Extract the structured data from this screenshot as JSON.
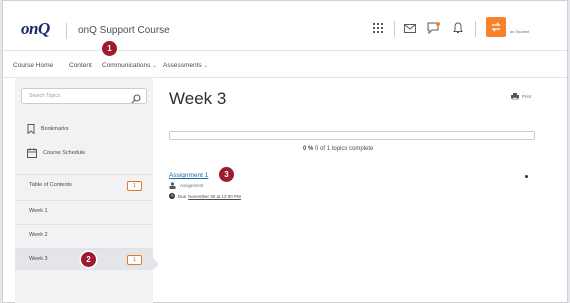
{
  "header": {
    "logo": "onQ",
    "course_title": "onQ Support Course",
    "role_label": "as Student",
    "icons": [
      "waffle-icon",
      "mail-icon",
      "chat-icon",
      "bell-icon",
      "role-switch-icon"
    ],
    "colors": {
      "accent": "#f7822b",
      "logo": "#1b2a6b"
    }
  },
  "nav": {
    "items": [
      {
        "label": "Course Home"
      },
      {
        "label": "Content"
      },
      {
        "label": "Communications",
        "dropdown": true
      },
      {
        "label": "Assessments",
        "dropdown": true
      }
    ]
  },
  "markers": {
    "m1": "1",
    "m2": "2",
    "m3": "3"
  },
  "sidebar": {
    "search_placeholder": "Search Topics",
    "bookmarks": "Bookmarks",
    "schedule": "Course Schedule",
    "toc": {
      "label": "Table of Contents",
      "count": "1"
    },
    "weeks": [
      {
        "label": "Week 1"
      },
      {
        "label": "Week 2"
      },
      {
        "label": "Week 3",
        "count": "1",
        "active": true
      }
    ]
  },
  "main": {
    "title": "Week 3",
    "print": "Print",
    "progress": {
      "percent_label": "0 %",
      "text": "0 of 1 topics complete",
      "fraction": 0
    },
    "assignment": {
      "title": "Assignment 1",
      "type": "Assignment",
      "due_prefix": "Due",
      "due_date": "November 30 at 12:00 PM"
    }
  }
}
